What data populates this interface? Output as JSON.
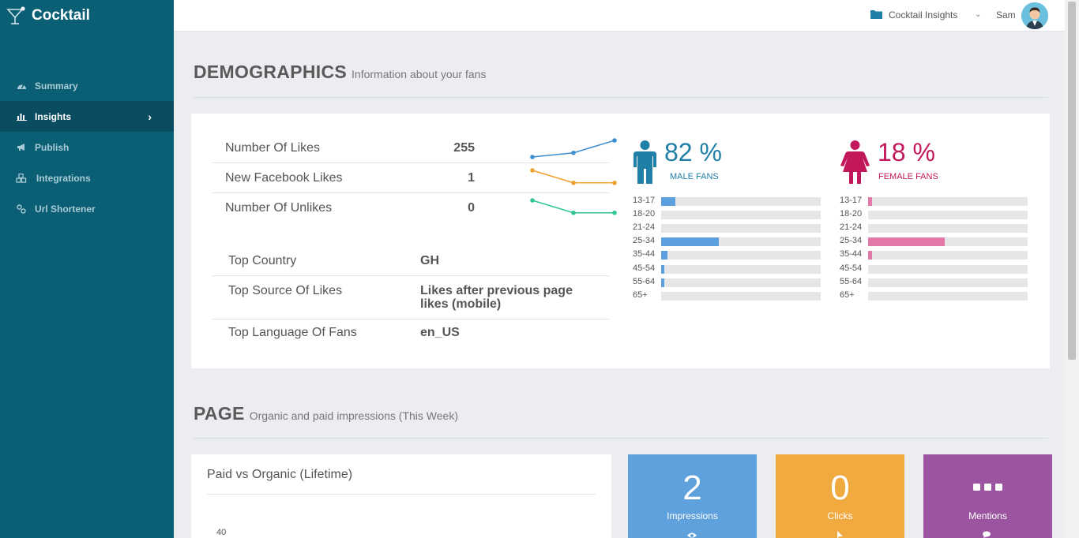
{
  "app": {
    "name": "Cocktail"
  },
  "sidebar": {
    "items": [
      {
        "label": "Summary",
        "icon": "dashboard-icon",
        "active": false
      },
      {
        "label": "Insights",
        "icon": "bar-chart-icon",
        "active": true
      },
      {
        "label": "Publish",
        "icon": "megaphone-icon",
        "active": false
      },
      {
        "label": "Integrations",
        "icon": "cubes-icon",
        "active": false
      },
      {
        "label": "Url Shortener",
        "icon": "link-icon",
        "active": false
      }
    ]
  },
  "topbar": {
    "app_selector": "Cocktail Insights",
    "user_name": "Sam"
  },
  "demographics": {
    "title": "DEMOGRAPHICS",
    "subtitle": "Information about your fans",
    "stats": [
      {
        "label": "Number Of Likes",
        "value": "255",
        "color": "#3b8dd0",
        "trend": [
          0,
          1,
          4
        ]
      },
      {
        "label": "New Facebook Likes",
        "value": "1",
        "color": "#f0a030",
        "trend": [
          4,
          1,
          1
        ]
      },
      {
        "label": "Number Of Unlikes",
        "value": "0",
        "color": "#2ec495",
        "trend": [
          4,
          1,
          1
        ]
      }
    ],
    "info": [
      {
        "label": "Top Country",
        "value": "GH"
      },
      {
        "label": "Top Source Of Likes",
        "value": "Likes after previous page likes (mobile)"
      },
      {
        "label": "Top Language Of Fans",
        "value": "en_US"
      }
    ],
    "male": {
      "percent": "82 %",
      "caption": "MALE FANS",
      "color": "#1f7fa6",
      "bar_color": "#5b9fdf",
      "ages": [
        {
          "range": "13-17",
          "pct": 9
        },
        {
          "range": "18-20",
          "pct": 0
        },
        {
          "range": "21-24",
          "pct": 0
        },
        {
          "range": "25-34",
          "pct": 36
        },
        {
          "range": "35-44",
          "pct": 4
        },
        {
          "range": "45-54",
          "pct": 2
        },
        {
          "range": "55-64",
          "pct": 2
        },
        {
          "range": "65+",
          "pct": 0
        }
      ]
    },
    "female": {
      "percent": "18 %",
      "caption": "FEMALE FANS",
      "color": "#c2185b",
      "bar_color": "#e279a8",
      "ages": [
        {
          "range": "13-17",
          "pct": 2.5
        },
        {
          "range": "18-20",
          "pct": 0
        },
        {
          "range": "21-24",
          "pct": 0
        },
        {
          "range": "25-34",
          "pct": 48
        },
        {
          "range": "35-44",
          "pct": 2.5
        },
        {
          "range": "45-54",
          "pct": 0
        },
        {
          "range": "55-64",
          "pct": 0
        },
        {
          "range": "65+",
          "pct": 0
        }
      ]
    }
  },
  "page_section": {
    "title": "PAGE",
    "subtitle": "Organic and paid impressions (This Week)",
    "chart": {
      "title": "Paid vs Organic (Lifetime)",
      "first_tick": "40"
    },
    "tiles": [
      {
        "value": "2",
        "label": "Impressions",
        "color": "#5ea1dd",
        "icon": "eye-icon"
      },
      {
        "value": "0",
        "label": "Clicks",
        "color": "#f0aa40",
        "icon": "cursor-icon"
      },
      {
        "value": "",
        "label": "Mentions",
        "color": "#9b55a0",
        "icon": "ellipsis-icon"
      }
    ]
  }
}
